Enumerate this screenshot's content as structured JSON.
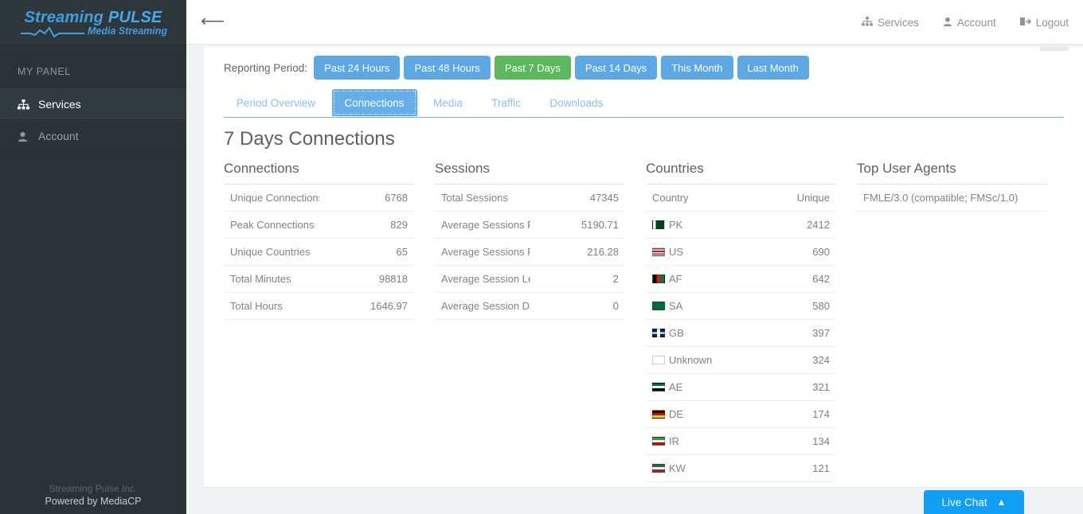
{
  "brand": {
    "line1_a": "Streaming",
    "line1_b": "PULSE",
    "line2": "Media Streaming"
  },
  "sidebar": {
    "section_label": "MY PANEL",
    "items": [
      {
        "label": "Services",
        "icon": "sitemap-icon",
        "active": true
      },
      {
        "label": "Account",
        "icon": "user-icon",
        "active": false
      }
    ],
    "footer_line1": "Streaming Pulse Inc.",
    "footer_line2": "Powered by MediaCP"
  },
  "topbar": {
    "back_icon": "arrow-left-icon",
    "nav": [
      {
        "label": "Services",
        "icon": "sitemap-icon"
      },
      {
        "label": "Account",
        "icon": "user-icon"
      },
      {
        "label": "Logout",
        "icon": "logout-icon"
      }
    ]
  },
  "reporting": {
    "label": "Reporting Period:",
    "buttons": [
      {
        "label": "Past 24 Hours",
        "selected": false
      },
      {
        "label": "Past 48 Hours",
        "selected": false
      },
      {
        "label": "Past 7 Days",
        "selected": true
      },
      {
        "label": "Past 14 Days",
        "selected": false
      },
      {
        "label": "This Month",
        "selected": false
      },
      {
        "label": "Last Month",
        "selected": false
      }
    ]
  },
  "tabs": [
    {
      "label": "Period Overview",
      "active": false
    },
    {
      "label": "Connections",
      "active": true
    },
    {
      "label": "Media",
      "active": false
    },
    {
      "label": "Traffic",
      "active": false
    },
    {
      "label": "Downloads",
      "active": false
    }
  ],
  "page_title": "7 Days Connections",
  "panels": {
    "connections": {
      "title": "Connections",
      "rows": [
        {
          "label": "Unique Connections",
          "value": "6768"
        },
        {
          "label": "Peak Connections",
          "value": "829"
        },
        {
          "label": "Unique Countries",
          "value": "65"
        },
        {
          "label": "Total Minutes",
          "value": "98818"
        },
        {
          "label": "Total Hours",
          "value": "1646.97"
        }
      ]
    },
    "sessions": {
      "title": "Sessions",
      "rows": [
        {
          "label": "Total Sessions",
          "value": "47345"
        },
        {
          "label": "Average Sessions Per Day",
          "value": "5190.71"
        },
        {
          "label": "Average Sessions Per Hour",
          "value": "216.28"
        },
        {
          "label": "Average Session Length (Mins)",
          "value": "2"
        },
        {
          "label": "Average Session Data (MB)",
          "value": "0"
        }
      ]
    },
    "countries": {
      "title": "Countries",
      "header_country": "Country",
      "header_unique": "Unique",
      "rows": [
        {
          "code": "PK",
          "value": "2412",
          "flag": "pk-flag-icon"
        },
        {
          "code": "US",
          "value": "690",
          "flag": "us-flag-icon"
        },
        {
          "code": "AF",
          "value": "642",
          "flag": "af-flag-icon"
        },
        {
          "code": "SA",
          "value": "580",
          "flag": "sa-flag-icon"
        },
        {
          "code": "GB",
          "value": "397",
          "flag": "gb-flag-icon"
        },
        {
          "code": "Unknown",
          "value": "324",
          "flag": "unknown-flag-icon"
        },
        {
          "code": "AE",
          "value": "321",
          "flag": "ae-flag-icon"
        },
        {
          "code": "DE",
          "value": "174",
          "flag": "de-flag-icon"
        },
        {
          "code": "IR",
          "value": "134",
          "flag": "ir-flag-icon"
        },
        {
          "code": "KW",
          "value": "121",
          "flag": "kw-flag-icon"
        }
      ]
    },
    "user_agents": {
      "title": "Top User Agents",
      "rows": [
        {
          "label": "FMLE/3.0 (compatible; FMSc/1.0)"
        }
      ]
    }
  },
  "live_chat": {
    "label": "Live Chat",
    "chevron": "chevron-up-icon"
  },
  "colors": {
    "sidebar": "#2b3338",
    "accent_blue": "#5ba8e5",
    "accent_green": "#5cb85c",
    "chat_blue": "#129ef4",
    "page_bg": "#eff3f4"
  }
}
